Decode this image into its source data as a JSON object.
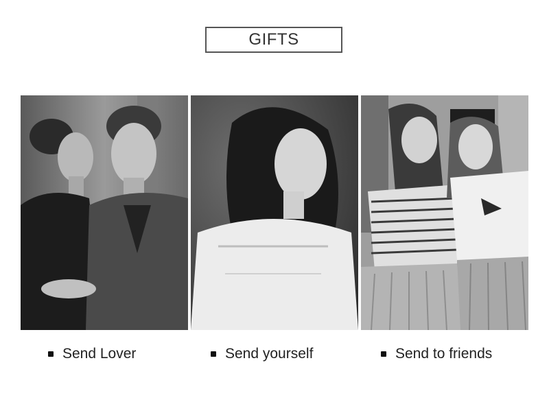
{
  "header": {
    "title": "GIFTS"
  },
  "panels": [
    {
      "caption": "Send Lover",
      "image": "couple-photo"
    },
    {
      "caption": "Send yourself",
      "image": "woman-portrait-photo"
    },
    {
      "caption": "Send to friends",
      "image": "two-friends-photo"
    }
  ],
  "colors": {
    "text": "#222222",
    "border": "#555555",
    "photo_tone": "grayscale"
  }
}
